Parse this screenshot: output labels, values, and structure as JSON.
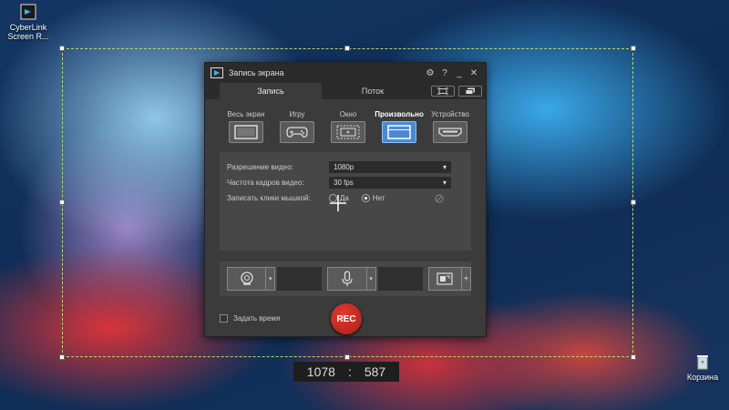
{
  "desktop": {
    "app_icon_label": "CyberLink Screen R...",
    "trash_label": "Корзина"
  },
  "window": {
    "title": "Запись экрана",
    "titlebar_buttons": [
      "gear-icon",
      "?",
      "_",
      "✕"
    ],
    "tabs": [
      {
        "label": "Запись",
        "active": true
      },
      {
        "label": "Поток",
        "active": false
      }
    ],
    "modes": [
      {
        "label": "Весь экран",
        "icon": "monitor-icon",
        "active": false
      },
      {
        "label": "Игру",
        "icon": "gamepad-icon",
        "active": false
      },
      {
        "label": "Окно",
        "icon": "window-icon",
        "active": false
      },
      {
        "label": "Произвольно",
        "icon": "region-icon",
        "active": true
      },
      {
        "label": "Устройство",
        "icon": "hdmi-icon",
        "active": false
      }
    ],
    "settings": {
      "resolution_label": "Разрешение видео:",
      "resolution_value": "1080p",
      "fps_label": "Частота кадров видео:",
      "fps_value": "30 fps",
      "clicks_label": "Записать клики мышкой:",
      "clicks_yes": "Да",
      "clicks_no": "Нет",
      "clicks_selected": "Нет"
    },
    "devices": {
      "webcam_icon": "webcam-icon",
      "mic_icon": "microphone-icon",
      "extra_icon": "screen-add-icon",
      "extra_plus": "+"
    },
    "schedule_label": "Задать время",
    "rec_label": "REC"
  },
  "capture": {
    "width": "1078",
    "separator": ":",
    "height": "587"
  },
  "colors": {
    "selection_border": "#b7d86b",
    "active_mode": "#4a8ad4",
    "rec_button": "#c8261e"
  }
}
